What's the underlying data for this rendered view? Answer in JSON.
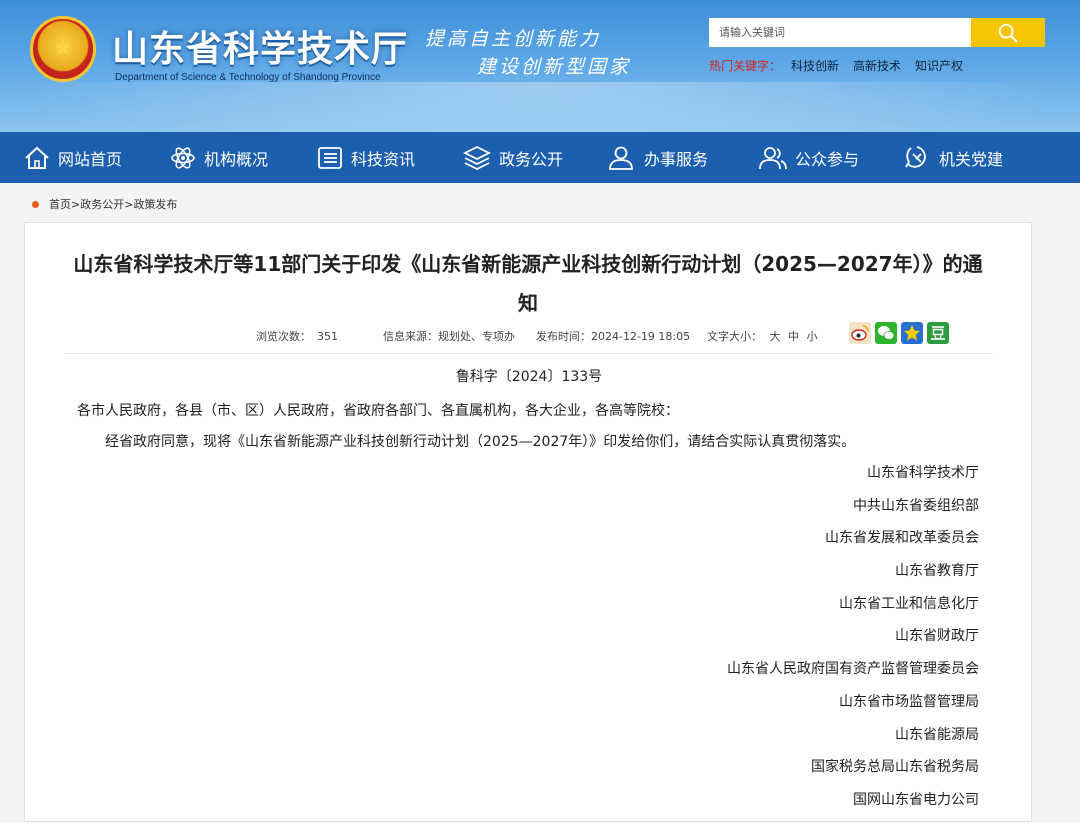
{
  "header": {
    "site_title": "山东省科学技术厅",
    "site_subtitle": "Department of Science & Technology of Shandong Province",
    "slogan_line1": "提高自主创新能力",
    "slogan_line2": "建设创新型国家",
    "search_placeholder": "请输入关键词",
    "hot_label": "热门关键字：",
    "hot_keywords": [
      "科技创新",
      "高新技术",
      "知识产权"
    ]
  },
  "nav": {
    "items": [
      {
        "label": "网站首页",
        "icon": "home-icon"
      },
      {
        "label": "机构概况",
        "icon": "atom-icon"
      },
      {
        "label": "科技资讯",
        "icon": "news-icon"
      },
      {
        "label": "政务公开",
        "icon": "layers-icon"
      },
      {
        "label": "办事服务",
        "icon": "user-service-icon"
      },
      {
        "label": "公众参与",
        "icon": "people-icon"
      },
      {
        "label": "机关党建",
        "icon": "party-icon"
      }
    ]
  },
  "breadcrumb": [
    "首页",
    "政务公开",
    "政策发布"
  ],
  "article": {
    "title": "山东省科学技术厅等11部门关于印发《山东省新能源产业科技创新行动计划（2025—2027年）》的通知",
    "views_label": "浏览次数：",
    "views": "351",
    "source_label": "信息来源：",
    "source": "规划处、专项办",
    "date_label": "发布时间：",
    "date": "2024-12-19 18:05",
    "fontsize_label": "文字大小：",
    "fontsize_large": "大",
    "fontsize_medium": "中",
    "fontsize_small": "小",
    "doc_number": "鲁科字〔2024〕133号",
    "addressee": "各市人民政府，各县（市、区）人民政府，省政府各部门、各直属机构，各大企业，各高等院校：",
    "body": "经省政府同意，现将《山东省新能源产业科技创新行动计划（2025—2027年）》印发给你们，请结合实际认真贯彻落实。",
    "signers": [
      "山东省科学技术厅",
      "中共山东省委组织部",
      "山东省发展和改革委员会",
      "山东省教育厅",
      "山东省工业和信息化厅",
      "山东省财政厅",
      "山东省人民政府国有资产监督管理委员会",
      "山东省市场监督管理局",
      "山东省能源局",
      "国家税务总局山东省税务局",
      "国网山东省电力公司"
    ]
  },
  "colors": {
    "nav_bg": "#1b5fae",
    "search_button": "#f7c400",
    "hot_label": "#d6241c",
    "breadcrumb_dot": "#f05a1a"
  }
}
